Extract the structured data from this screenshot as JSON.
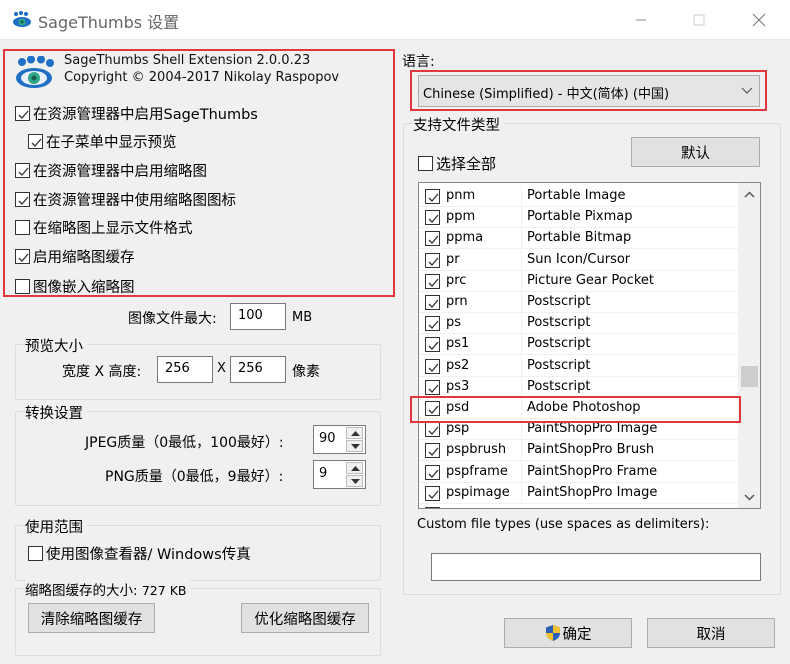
{
  "window": {
    "title": "SageThumbs 设置",
    "minimize_icon": "minimize-icon",
    "maximize_icon": "maximize-icon",
    "close_icon": "close-icon"
  },
  "header": {
    "logo_icon": "sagethumbs-eye-paw-icon",
    "product_line": "SageThumbs Shell Extension 2.0.0.23",
    "copyright_line": "Copyright © 2004-2017 Nikolay Raspopov"
  },
  "options": [
    {
      "label": "在资源管理器中启用SageThumbs",
      "checked": true
    },
    {
      "label": "在子菜单中显示预览",
      "checked": true
    },
    {
      "label": "在资源管理器中启用缩略图",
      "checked": true
    },
    {
      "label": "在资源管理器中使用缩略图图标",
      "checked": true
    },
    {
      "label": "在缩略图上显示文件格式",
      "checked": false
    },
    {
      "label": "启用缩略图缓存",
      "checked": true
    },
    {
      "label": "图像嵌入缩略图",
      "checked": false
    }
  ],
  "max_file": {
    "label": "图像文件最大:",
    "value": "100",
    "unit": "MB"
  },
  "preview_size": {
    "group_title": "预览大小",
    "label": "宽度 X 高度:",
    "width": "256",
    "separator": "X",
    "height": "256",
    "unit": "像素"
  },
  "conversion": {
    "group_title": "转换设置",
    "jpeg_label": "JPEG质量（0最低，100最好）:",
    "jpeg_value": "90",
    "png_label": "PNG质量（0最低，9最好）:",
    "png_value": "9"
  },
  "usage": {
    "group_title": "使用范围",
    "viewer_label": "使用图像查看器/ Windows传真",
    "viewer_checked": false
  },
  "cache": {
    "size_label": "缩略图缓存的大小:",
    "size_value": "727 KB",
    "clear_button": "清除缩略图缓存",
    "optimize_button": "优化缩略图缓存"
  },
  "language": {
    "label": "语言:",
    "selected": "Chinese (Simplified) - 中文(简体) (中国)"
  },
  "file_types": {
    "group_title": "支持文件类型",
    "select_all_label": "选择全部",
    "select_all_checked": false,
    "default_button": "默认",
    "rows": [
      {
        "ext": "pnm",
        "desc": "Portable Image",
        "checked": true
      },
      {
        "ext": "ppm",
        "desc": "Portable Pixmap",
        "checked": true
      },
      {
        "ext": "ppma",
        "desc": "Portable Bitmap",
        "checked": true
      },
      {
        "ext": "pr",
        "desc": "Sun Icon/Cursor",
        "checked": true
      },
      {
        "ext": "prc",
        "desc": "Picture Gear Pocket",
        "checked": true
      },
      {
        "ext": "prn",
        "desc": "Postscript",
        "checked": true
      },
      {
        "ext": "ps",
        "desc": "Postscript",
        "checked": true
      },
      {
        "ext": "ps1",
        "desc": "Postscript",
        "checked": true
      },
      {
        "ext": "ps2",
        "desc": "Postscript",
        "checked": true
      },
      {
        "ext": "ps3",
        "desc": "Postscript",
        "checked": true
      },
      {
        "ext": "psd",
        "desc": "Adobe Photoshop",
        "checked": true
      },
      {
        "ext": "psp",
        "desc": "PaintShopPro Image",
        "checked": true
      },
      {
        "ext": "pspbrush",
        "desc": "PaintShopPro Brush",
        "checked": true
      },
      {
        "ext": "pspframe",
        "desc": "PaintShopPro Frame",
        "checked": true
      },
      {
        "ext": "pspimage",
        "desc": "PaintShopPro Image",
        "checked": true
      }
    ],
    "custom_label": "Custom file types (use spaces as delimiters):",
    "custom_value": ""
  },
  "footer": {
    "ok_button": "确定",
    "ok_icon": "uac-shield-icon",
    "cancel_button": "取消"
  },
  "highlight_color": "#e0383e"
}
